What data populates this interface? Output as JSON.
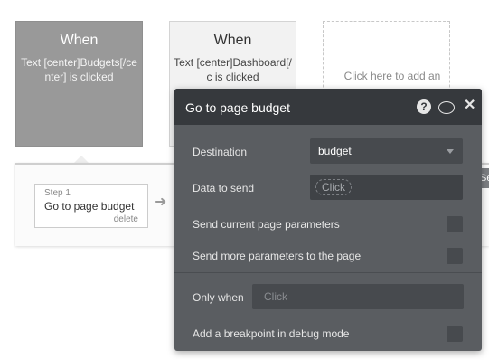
{
  "events": [
    {
      "title": "When",
      "description": "Text [center]Budgets[/center] is clicked",
      "state": "selected"
    },
    {
      "title": "When",
      "description": "Text [center]Dashboard[/c is clicked",
      "state": "normal"
    }
  ],
  "add_event_text": "Click here to add an",
  "workflow": {
    "step_number": "Step 1",
    "step_title": "Go to page budget",
    "delete_label": "delete"
  },
  "side_tab": {
    "text": "Se"
  },
  "panel": {
    "title": "Go to page budget",
    "destination_label": "Destination",
    "destination_value": "budget",
    "data_to_send_label": "Data to send",
    "data_to_send_value": "Click",
    "send_current_params_label": "Send current page parameters",
    "send_current_params_checked": false,
    "send_more_params_label": "Send more parameters to the page",
    "send_more_params_checked": false,
    "only_when_label": "Only when",
    "only_when_placeholder": "Click",
    "breakpoint_label": "Add a breakpoint in debug mode",
    "breakpoint_checked": false
  },
  "icons": {
    "help": "question-circle-icon",
    "comment": "comment-icon",
    "close": "close-icon",
    "arrow": "arrow-right-icon",
    "caret": "caret-down-icon"
  },
  "colors": {
    "panel_bg": "#5a5d61",
    "panel_header": "#36393d",
    "selected_event": "#999999"
  }
}
